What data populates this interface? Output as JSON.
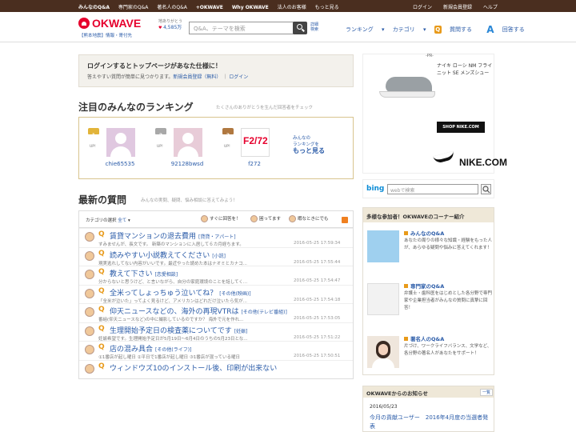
{
  "topbar": {
    "left": [
      "みんなのQ&A",
      "専門家のQ&A",
      "著名人のQ&A",
      "+OKWAVE",
      "Why OKWAVE",
      "法人のお客様",
      "もっと見る"
    ],
    "right": [
      "ログイン",
      "新規会員登録",
      "ヘルプ"
    ]
  },
  "header": {
    "logo": "OKWAVE",
    "subtag": "【熊本地震】情報・寄付先",
    "thanks_label": "地ありがとう",
    "thanks_count": "4,585万",
    "search_placeholder": "Q&A、テーマを検索",
    "advanced": "詳細\n検索",
    "nav": [
      "ランキング",
      "カテゴリ",
      "質問する",
      "回答する"
    ]
  },
  "login": {
    "title": "ログインするとトップページがあなた仕様に！",
    "text": "答えやすい質問が簡単に見つかります。",
    "register": "新規会員登録（無料）",
    "login": "ログイン"
  },
  "ranking": {
    "title": "注目のみんなのランキング",
    "sub": "たくさんのありがとうを生んだ回答者をチェック",
    "users": [
      {
        "rank": "1",
        "up": "UP!",
        "name": "chie65535",
        "crown": "#e2b43a",
        "avbg": "#e0c8e0"
      },
      {
        "rank": "2",
        "up": "UP!",
        "name": "92128bwsd",
        "crown": "#a8a8a8",
        "avbg": "#e8ccd8"
      },
      {
        "rank": "3",
        "up": "UP!",
        "name": "f272",
        "crown": "#b07840",
        "avbg": "#ffffff"
      }
    ],
    "avatar3_text": "F2/72",
    "more_pre": "みんなの\nランキングを",
    "more": "もっと見る"
  },
  "questions": {
    "title": "最新の質問",
    "sub": "みんなの実問、疑問、悩み相談に答えてみよう！",
    "cat_label": "カテゴリの選択",
    "cat_value": "全て",
    "filters": [
      "すぐに回答を！",
      "困ってます",
      "暇なときにでも"
    ],
    "items": [
      {
        "title": "賃貸マンションの退去費用",
        "cat": "[貸貸・アパート]",
        "excerpt": "すみませんが、長文です。 新築のマンションに入居して６カ月経ちます。",
        "date": "2016-05-25 17:59:34"
      },
      {
        "title": "読みやすい小説教えてください",
        "cat": "[小説]",
        "excerpt": "現実逃れしてない内容がいいです。最近やった読めた本はナオミとカナコ...",
        "date": "2016-05-25 17:55:44"
      },
      {
        "title": "教えて下さい",
        "cat": "[恋愛相談]",
        "excerpt": "分からないと思うけど、と言いながら、自分の家庭環境のことを話してく...",
        "date": "2016-05-25 17:54:47"
      },
      {
        "title": "全米ってしょっちゅう泣いてね？",
        "cat": "[その他(映画)]",
        "excerpt": "「全米が泣いた」ってよく見るけど、アメリカンはどれだけ泣いたら気が...",
        "date": "2016-05-25 17:54:18"
      },
      {
        "title": "仰天ニュースなどの、海外の再現VTRは",
        "cat": "[その他(テレビ番組)]",
        "excerpt": "番組(仰天ニュースなど)の中に撮影しているのですか？ 海外で元を作れ...",
        "date": "2016-05-25 17:53:05"
      },
      {
        "title": "生理開始予定日の検査薬についてです",
        "cat": "[妊娠]",
        "excerpt": "妊娠希望です。生理開始予定日が5月19日〜6月4日のうちの5月23日とな...",
        "date": "2016-05-25 17:51:22"
      },
      {
        "title": "店の混み具合",
        "cat": "[その他(ライフ)]",
        "excerpt": "①1番店が起し曜日 ②平日で1番店が起し曜日 ③1番店が混っている曜日",
        "date": "2016-05-25 17:50:51"
      },
      {
        "title": "ウィンドウズ10のインストール後、印刷が出来ない",
        "cat": "",
        "excerpt": "",
        "date": ""
      }
    ]
  },
  "ad": {
    "pr": "-PR-",
    "product": "ナイキ ローシ NM フライニット SE メンズシュー",
    "shop": "SHOP NIKE.COM",
    "brand": "NIKE.COM"
  },
  "bing": {
    "logo": "bing",
    "placeholder": "webで検索"
  },
  "corners": {
    "title": "多様な参加者！OKWAVEのコーナー紹介",
    "items": [
      {
        "title": "みんなのQ&A",
        "desc": "あなたの周りの様々な知識・経験をもった人が、あらゆる疑問や悩みに答えてくれます！"
      },
      {
        "title": "専門家のQ&A",
        "desc": "弁護士・歯科医をはじめとした各分野で専門家や企業担当者がみんなの質問に真摯に回答！"
      },
      {
        "title": "著名人のQ&A",
        "desc": "片づけ、ワークライフバランス、文学など、各分野の著名人があなたをサポート！"
      }
    ]
  },
  "news": {
    "title": "OKWAVEからのお知らせ",
    "all": "一覧",
    "date": "2016/05/23",
    "headline": "今月の貢献ユーザー　2016年4月度の当選者発表"
  }
}
